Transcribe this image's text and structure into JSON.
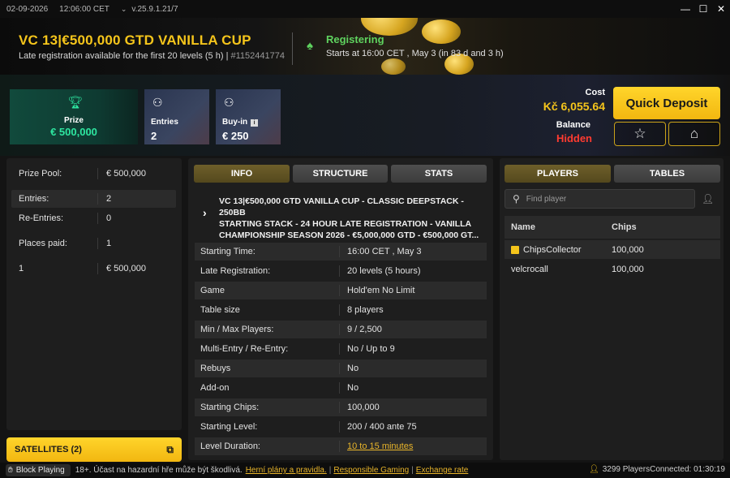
{
  "titlebar": {
    "date": "02-09-2026",
    "time": "12:06:00 CET",
    "version_caret": "⌄",
    "version": "v.25.9.1.21/7"
  },
  "window_controls": {
    "minimize": "—",
    "maximize": "☐",
    "close": "✕"
  },
  "header": {
    "title": "VC 13|€500,000 GTD VANILLA CUP",
    "subtitle": "Late registration available for the first 20 levels (5 h) | ",
    "tournament_id": "#1152441774",
    "status": "Registering",
    "starts": "Starts at 16:00 CET , May 3 (in 83 d and 3 h)"
  },
  "cards": {
    "prize": {
      "label": "Prize",
      "value": "€ 500,000"
    },
    "entries": {
      "label": "Entries",
      "value": "2"
    },
    "buyin": {
      "label": "Buy-in",
      "value": "€ 250"
    }
  },
  "account": {
    "cost_label": "Cost",
    "cost_value": "Kč 6,055.64",
    "balance_label": "Balance",
    "balance_value": "Hidden",
    "quick_deposit": "Quick Deposit"
  },
  "summary": [
    {
      "k": "Prize Pool:",
      "v": "€ 500,000"
    },
    {
      "k": "Entries:",
      "v": "2"
    },
    {
      "k": "Re-Entries:",
      "v": "0"
    },
    {
      "k": "Places paid:",
      "v": "1"
    },
    {
      "k": "1",
      "v": "€ 500,000"
    }
  ],
  "satellites": "SATELLITES (2)",
  "tabs": {
    "info": "INFO",
    "structure": "STRUCTURE",
    "stats": "STATS"
  },
  "description": "VC 13|€500,000 GTD VANILLA CUP - CLASSIC DEEPSTACK - 250BB\nSTARTING STACK - 24 HOUR LATE REGISTRATION - VANILLA\nCHAMPIONSHIP SEASON 2026 - €5,000,000 GTD - €500,000 GT...",
  "details": [
    {
      "k": "Starting Time:",
      "v": "16:00 CET , May 3"
    },
    {
      "k": "Late Registration:",
      "v": "20 levels (5 hours)"
    },
    {
      "k": "Game",
      "v": "Hold'em No Limit"
    },
    {
      "k": "Table size",
      "v": "8 players"
    },
    {
      "k": "Min / Max Players:",
      "v": "9 / 2,500"
    },
    {
      "k": "Multi-Entry / Re-Entry:",
      "v": "No / Up to 9"
    },
    {
      "k": "Rebuys",
      "v": "No"
    },
    {
      "k": "Add-on",
      "v": "No"
    },
    {
      "k": "Starting Chips:",
      "v": "100,000"
    },
    {
      "k": "Starting Level:",
      "v": "200 / 400 ante 75"
    },
    {
      "k": "Level Duration:",
      "v": "10 to 15 minutes"
    }
  ],
  "right_tabs": {
    "players": "PLAYERS",
    "tables": "TABLES"
  },
  "search": {
    "placeholder": "Find player"
  },
  "players_table": {
    "headers": {
      "name": "Name",
      "chips": "Chips"
    },
    "rows": [
      {
        "name": "ChipsCollector",
        "chips": "100,000"
      },
      {
        "name": "velcrocall",
        "chips": "100,000"
      }
    ]
  },
  "footer": {
    "block_playing": "Block Playing",
    "warning": "18+. Účast na hazardní hře může být škodlivá.",
    "link_plans": "Herní plány a pravidla.",
    "link_responsible": "Responsible Gaming",
    "link_exchange": "Exchange rate",
    "separator": "|",
    "players_online": "3299 Players",
    "connected": "Connected: 01:30:19"
  },
  "icons": {
    "spade": "spade-icon",
    "trophy": "trophy-icon",
    "medal": "medal-icon",
    "star": "star-icon",
    "home": "home-icon",
    "search": "search-icon",
    "user": "user-icon",
    "external": "external-link-icon",
    "hand": "hand-icon"
  }
}
